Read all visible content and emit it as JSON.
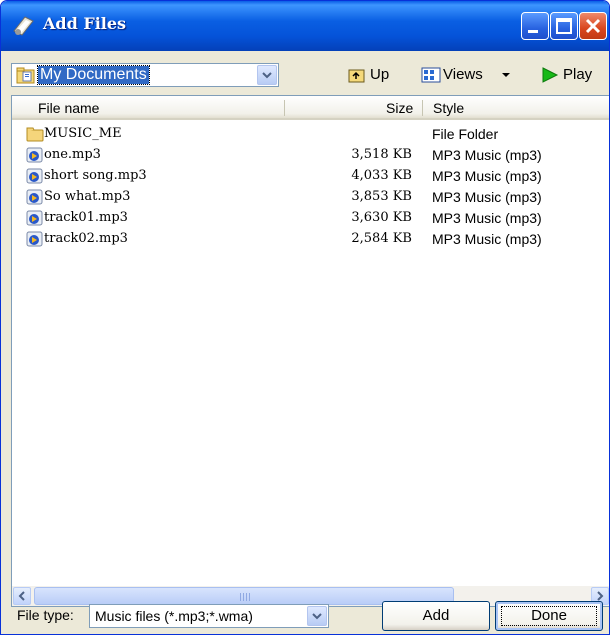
{
  "window": {
    "title": "Add Files",
    "accent": "#0553d9"
  },
  "toolbar": {
    "location": "My Documents",
    "up_label": "Up",
    "views_label": "Views",
    "play_label": "Play"
  },
  "list": {
    "columns": {
      "name": "File name",
      "size": "Size",
      "style": "Style"
    },
    "rows": [
      {
        "icon": "folder-icon",
        "name": "MUSIC_ME",
        "size": "",
        "style": "File Folder"
      },
      {
        "icon": "mp3-file-icon",
        "name": "one.mp3",
        "size": "3,518 KB",
        "style": "MP3 Music (mp3)"
      },
      {
        "icon": "mp3-file-icon",
        "name": "short song.mp3",
        "size": "4,033 KB",
        "style": "MP3 Music (mp3)"
      },
      {
        "icon": "mp3-file-icon",
        "name": "So what.mp3",
        "size": "3,853 KB",
        "style": "MP3 Music (mp3)"
      },
      {
        "icon": "mp3-file-icon",
        "name": "track01.mp3",
        "size": "3,630 KB",
        "style": "MP3 Music (mp3)"
      },
      {
        "icon": "mp3-file-icon",
        "name": "track02.mp3",
        "size": "2,584 KB",
        "style": "MP3 Music (mp3)"
      }
    ]
  },
  "footer": {
    "file_type_label": "File type:",
    "file_type_value": "Music files (*.mp3;*.wma)",
    "add_label": "Add",
    "done_label": "Done"
  }
}
